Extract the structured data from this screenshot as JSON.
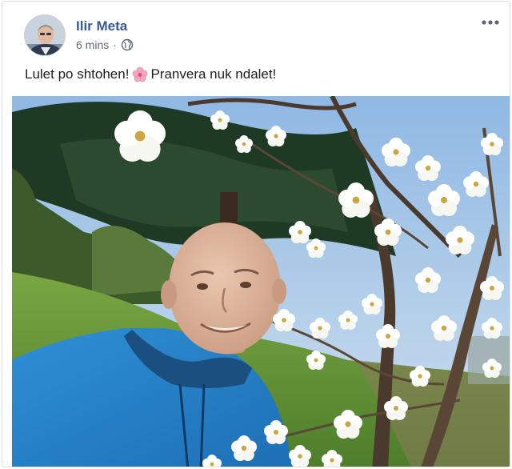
{
  "post": {
    "author": "Ilir Meta",
    "timestamp": "6 mins",
    "separator": "·",
    "privacy_icon": "globe-icon",
    "more_icon": "more-options-icon",
    "caption_part1": "Lulet po shtohen!",
    "caption_emoji": "cherry-blossom-icon",
    "caption_part2": " Pranvera nuk ndalet!",
    "colors": {
      "author_link": "#385898",
      "meta_text": "#606770",
      "body_text": "#1c1e21"
    }
  }
}
